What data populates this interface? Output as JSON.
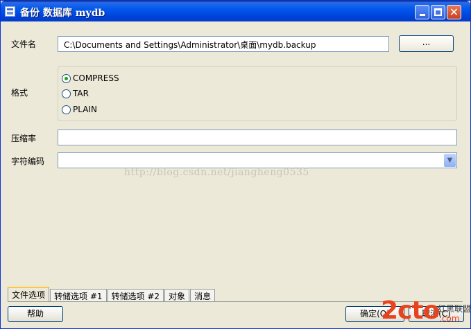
{
  "window": {
    "title": "备份 数据库 mydb",
    "controls": [
      "minimize-icon",
      "maximize-icon",
      "close-icon"
    ]
  },
  "form": {
    "filename_label": "文件名",
    "filename_value": "C:\\Documents and Settings\\Administrator\\桌面\\mydb.backup",
    "browse_label": "...",
    "format_label": "格式",
    "format_options": [
      "COMPRESS",
      "TAR",
      "PLAIN"
    ],
    "format_selected": "COMPRESS",
    "compression_label": "压缩率",
    "compression_value": "",
    "encoding_label": "字符编码",
    "encoding_value": ""
  },
  "watermark": "http://blog.csdn.net/jiangheng0535",
  "tabs": [
    "文件选项",
    "转储选项 #1",
    "转储选项 #2",
    "对象",
    "消息"
  ],
  "active_tab": "文件选项",
  "buttons": {
    "help": "帮助",
    "ok": "确定(O)",
    "cancel": "取消(C)"
  },
  "overlay_logo": {
    "big": "2cto",
    "small": "红黑联盟",
    "small2": ".com"
  },
  "colors": {
    "titlebar": "#0058ee",
    "dialog_bg": "#ece9d8",
    "field_border": "#7f9db9",
    "radio_dot": "#21a121",
    "active_tab_accent": "#ffc83c",
    "logo": "#e8431f"
  }
}
